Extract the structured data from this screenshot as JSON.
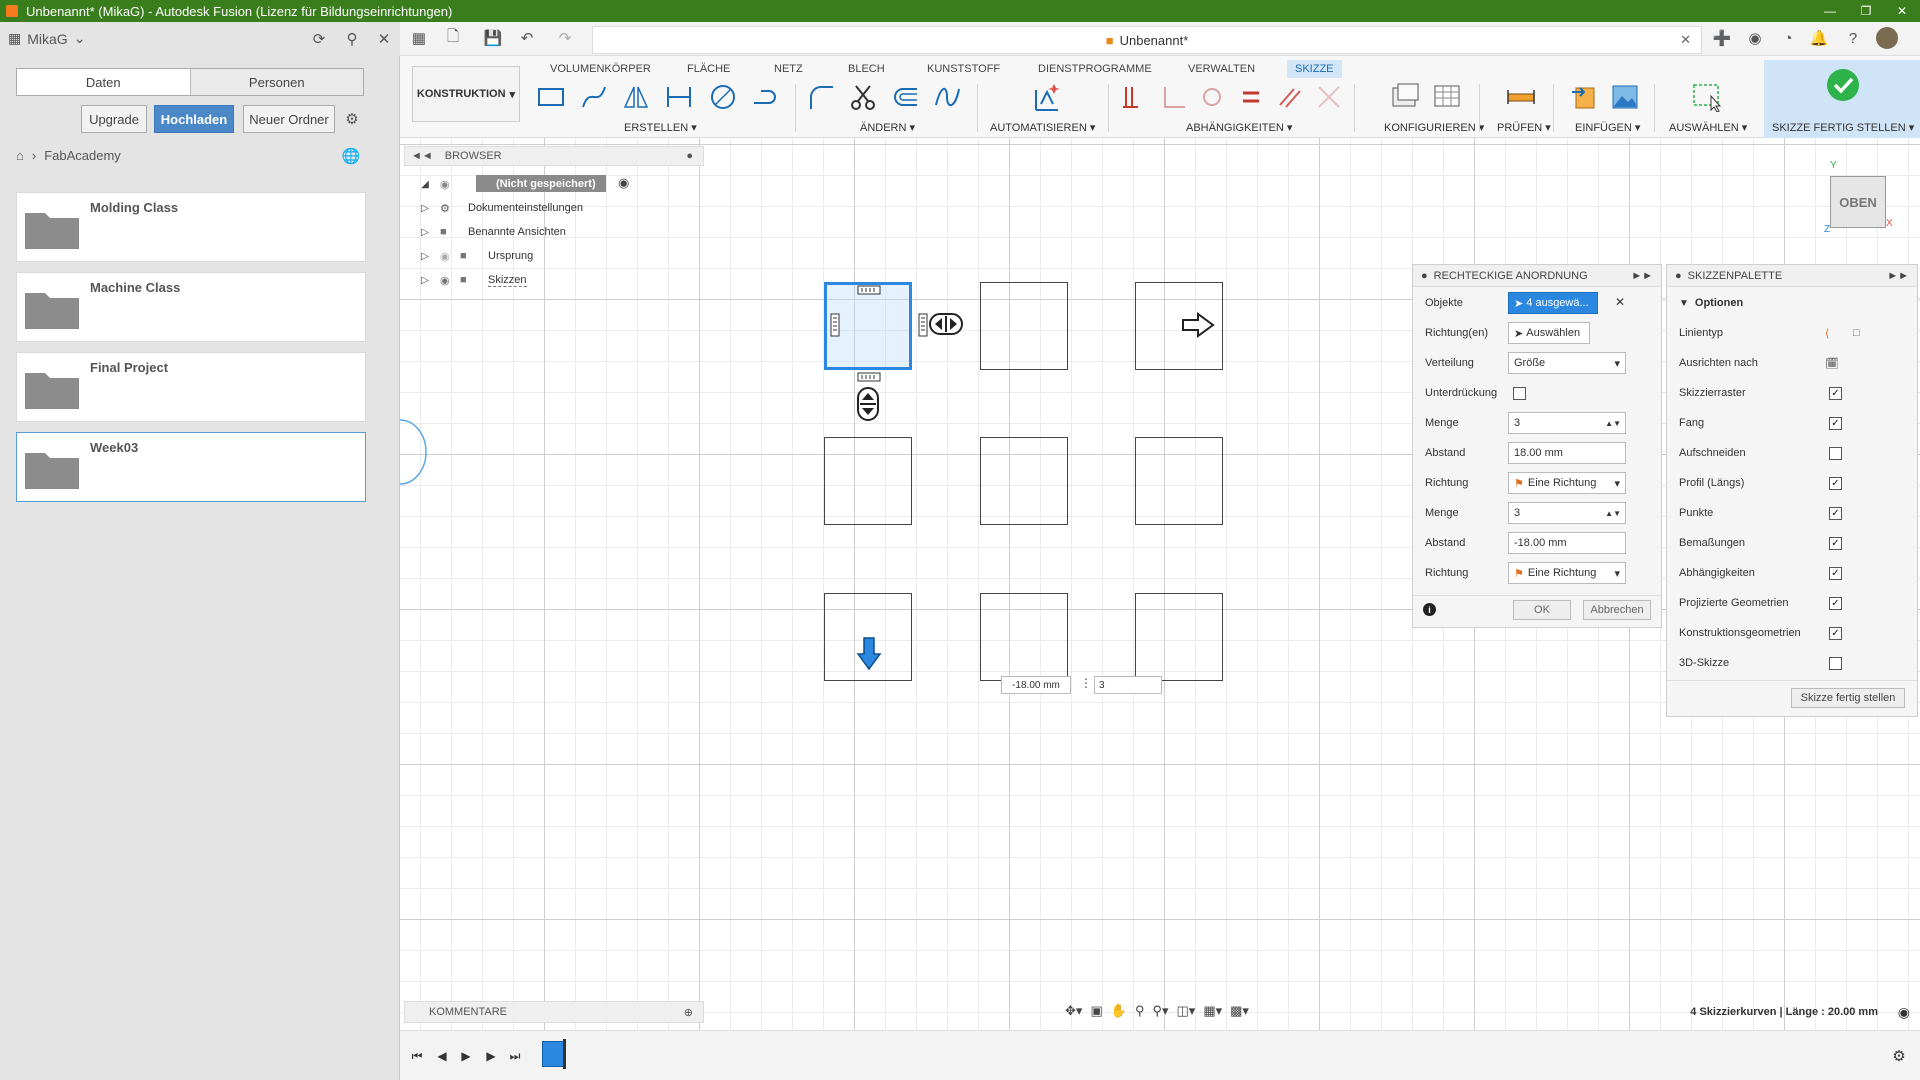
{
  "window": {
    "title": "Unbenannt* (MikaG) - Autodesk Fusion (Lizenz für Bildungseinrichtungen)"
  },
  "data_panel": {
    "user": "MikaG",
    "tabs": [
      "Daten",
      "Personen"
    ],
    "buttons": {
      "upgrade": "Upgrade",
      "upload": "Hochladen",
      "new_folder": "Neuer Ordner"
    },
    "breadcrumb": "FabAcademy",
    "folders": [
      {
        "name": "Molding Class"
      },
      {
        "name": "Machine Class"
      },
      {
        "name": "Final Project"
      },
      {
        "name": "Week03"
      }
    ]
  },
  "document_tab": {
    "title": "Unbenannt*"
  },
  "ribbon": {
    "tabs": [
      "VOLUMENKÖRPER",
      "FLÄCHE",
      "NETZ",
      "BLECH",
      "KUNSTSTOFF",
      "DIENSTPROGRAMME",
      "VERWALTEN",
      "SKIZZE"
    ],
    "active_tab": "SKIZZE",
    "workspace": "KONSTRUKTION",
    "groups": {
      "create": "ERSTELLEN",
      "modify": "ÄNDERN",
      "automate": "AUTOMATISIEREN",
      "constraints": "ABHÄNGIGKEITEN",
      "configure": "KONFIGURIEREN",
      "inspect": "PRÜFEN",
      "insert": "EINFÜGEN",
      "select": "AUSWÄHLEN",
      "finish": "SKIZZE FERTIG STELLEN"
    }
  },
  "browser": {
    "title": "BROWSER",
    "root": "(Nicht gespeichert)",
    "items": [
      "Dokumenteinstellungen",
      "Benannte Ansichten",
      "Ursprung",
      "Skizzen"
    ]
  },
  "viewcube": {
    "label": "OBEN",
    "axes": {
      "x": "X",
      "y": "Y",
      "z": "Z"
    }
  },
  "pattern_dialog": {
    "title": "RECHTECKIGE ANORDNUNG",
    "rows": {
      "objects_label": "Objekte",
      "objects_value": "4 ausgewä...",
      "directions_label": "Richtung(en)",
      "directions_value": "Auswählen",
      "distribution_label": "Verteilung",
      "distribution_value": "Größe",
      "suppress_label": "Unterdrückung",
      "qty1_label": "Menge",
      "qty1_value": "3",
      "dist1_label": "Abstand",
      "dist1_value": "18.00 mm",
      "dir1_label": "Richtung",
      "dir1_value": "Eine Richtung",
      "qty2_label": "Menge",
      "qty2_value": "3",
      "dist2_label": "Abstand",
      "dist2_value": "-18.00 mm",
      "dir2_label": "Richtung",
      "dir2_value": "Eine Richtung"
    },
    "ok": "OK",
    "cancel": "Abbrechen"
  },
  "sketch_palette": {
    "title": "SKIZZENPALETTE",
    "section": "Optionen",
    "options": [
      {
        "label": "Linientyp",
        "kind": "icons"
      },
      {
        "label": "Ausrichten nach",
        "kind": "icon"
      },
      {
        "label": "Skizzierraster",
        "checked": true
      },
      {
        "label": "Fang",
        "checked": true
      },
      {
        "label": "Aufschneiden",
        "checked": false
      },
      {
        "label": "Profil (Längs)",
        "checked": true
      },
      {
        "label": "Punkte",
        "checked": true
      },
      {
        "label": "Bemaßungen",
        "checked": true
      },
      {
        "label": "Abhängigkeiten",
        "checked": true
      },
      {
        "label": "Projizierte Geometrien",
        "checked": true
      },
      {
        "label": "Konstruktionsgeometrien",
        "checked": true
      },
      {
        "label": "3D-Skizze",
        "checked": false
      }
    ],
    "finish_button": "Skizze fertig stellen"
  },
  "canvas_inputs": {
    "distance": "-18.00 mm",
    "quantity": "3"
  },
  "comments": {
    "title": "KOMMENTARE"
  },
  "status": {
    "text": "4 Skizzierkurven | Länge : 20.00 mm"
  },
  "colors": {
    "titlebar": "#3a7d1d",
    "accent": "#2a88e0",
    "finish_green": "#2db34a"
  }
}
